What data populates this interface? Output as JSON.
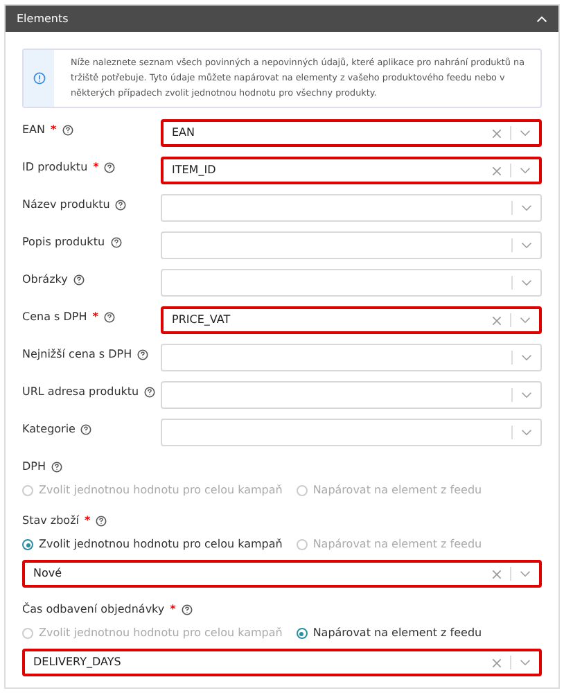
{
  "panel": {
    "title": "Elements",
    "expanded": true
  },
  "info": "Níže naleznete seznam všech povinných a nepovinných údajů, které aplikace pro nahrání produktů na tržiště potřebuje. Tyto údaje můžete napárovat na elementy z vašeho produktového feedu nebo v některých případech zvolit jednotnou hodnotu pro všechny produkty.",
  "fields": [
    {
      "kind": "select",
      "label": "EAN",
      "required_mark": "*",
      "value": "EAN",
      "highlighted": true
    },
    {
      "kind": "select",
      "label": "ID produktu",
      "required_mark": "*",
      "value": "ITEM_ID",
      "highlighted": true
    },
    {
      "kind": "select",
      "label": "Název produktu",
      "highlighted": false
    },
    {
      "kind": "select",
      "label": "Popis produktu",
      "highlighted": false
    },
    {
      "kind": "select",
      "label": "Obrázky",
      "highlighted": false
    },
    {
      "kind": "select",
      "label": "Cena s DPH",
      "required_mark": "*",
      "value": "PRICE_VAT",
      "highlighted": true
    },
    {
      "kind": "select",
      "label": "Nejnižší cena s DPH",
      "highlighted": false
    },
    {
      "kind": "select",
      "label": "URL adresa produktu",
      "highlighted": false
    },
    {
      "kind": "select",
      "label": "Kategorie",
      "highlighted": false
    },
    {
      "kind": "choice",
      "label": "DPH",
      "options": [
        {
          "label": "Zvolit jednotnou hodnotu pro celou kampaň",
          "selected": false
        },
        {
          "label": "Napárovat na element z feedu",
          "selected": false
        }
      ]
    },
    {
      "kind": "choice",
      "label": "Stav zboží",
      "required_mark": "*",
      "options": [
        {
          "label": "Zvolit jednotnou hodnotu pro celou kampaň",
          "selected": true
        },
        {
          "label": "Napárovat na element z feedu",
          "selected": false
        }
      ],
      "value": "Nové",
      "highlighted": true
    },
    {
      "kind": "choice",
      "label": "Čas odbavení objednávky",
      "required_mark": "*",
      "options": [
        {
          "label": "Zvolit jednotnou hodnotu pro celou kampaň",
          "selected": false
        },
        {
          "label": "Napárovat na element z feedu",
          "selected": true
        }
      ],
      "value": "DELIVERY_DAYS",
      "highlighted": true
    }
  ]
}
